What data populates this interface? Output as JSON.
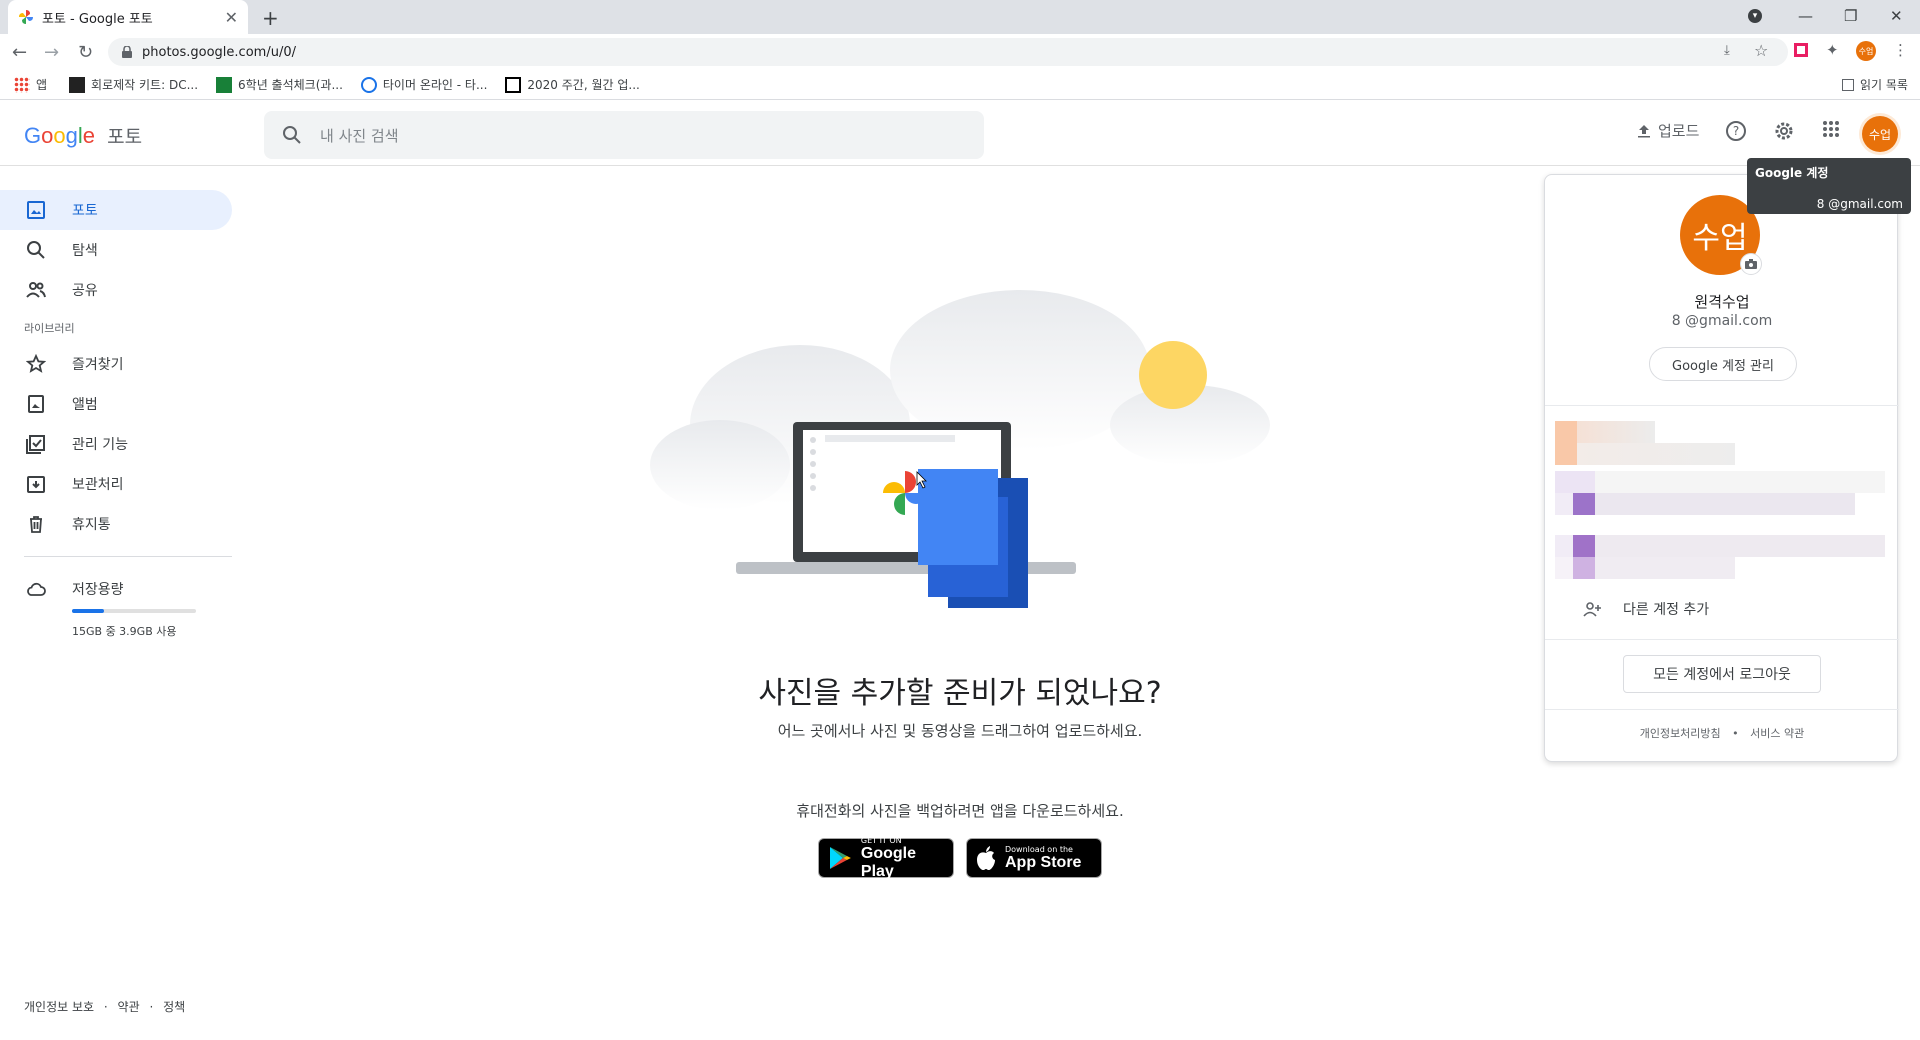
{
  "browser": {
    "tab_title": "포토 - Google 포토",
    "url": "photos.google.com/u/0/",
    "bookmarks": [
      {
        "label": "앱"
      },
      {
        "label": "회로제작 키트: DC..."
      },
      {
        "label": "6학년 출석체크(과..."
      },
      {
        "label": "타이머 온라인 - 타..."
      },
      {
        "label": "2020 주간, 월간 업..."
      }
    ],
    "reading_list": "읽기 목록",
    "profile_badge": "수업"
  },
  "header": {
    "logo_google": "Google",
    "logo_product": "포토",
    "search_placeholder": "내 사진 검색",
    "upload_label": "업로드",
    "avatar_text": "수업"
  },
  "sidebar": {
    "items": [
      {
        "label": "포토",
        "icon": "photo-icon",
        "active": true
      },
      {
        "label": "탐색",
        "icon": "search-icon"
      },
      {
        "label": "공유",
        "icon": "people-icon"
      }
    ],
    "library_header": "라이브러리",
    "library_items": [
      {
        "label": "즐겨찾기",
        "icon": "star-icon"
      },
      {
        "label": "앨범",
        "icon": "album-icon"
      },
      {
        "label": "관리 기능",
        "icon": "utilities-icon"
      },
      {
        "label": "보관처리",
        "icon": "archive-icon"
      },
      {
        "label": "휴지통",
        "icon": "trash-icon"
      }
    ],
    "storage": {
      "label": "저장용량",
      "usage_text": "15GB 중 3.9GB 사용",
      "used_fraction": 0.26
    }
  },
  "main": {
    "title": "사진을 추가할 준비가 되었나요?",
    "subtitle": "어느 곳에서나 사진 및 동영상을 드래그하여 업로드하세요.",
    "app_prompt": "휴대전화의 사진을 백업하려면 앱을 다운로드하세요.",
    "google_play": {
      "small": "GET IT ON",
      "big": "Google Play"
    },
    "app_store": {
      "small": "Download on the",
      "big": "App Store"
    }
  },
  "footer": {
    "privacy": "개인정보 보호",
    "terms": "약관",
    "policy": "정책",
    "sep": "·"
  },
  "account": {
    "avatar_text": "수업",
    "name": "원격수업",
    "email": "8 @gmail.com",
    "manage_label": "Google 계정 관리",
    "add_account": "다른 계정 추가",
    "logout_label": "모든 계정에서 로그아웃",
    "privacy_label": "개인정보처리방침",
    "terms_label": "서비스 약관",
    "bullet": "•"
  },
  "tooltip": {
    "title": "Google 계정",
    "email": "8 @gmail.com"
  },
  "colors": {
    "accent": "#1a73e8",
    "avatar": "#e8710a",
    "active_bg": "#e8f0fe"
  }
}
